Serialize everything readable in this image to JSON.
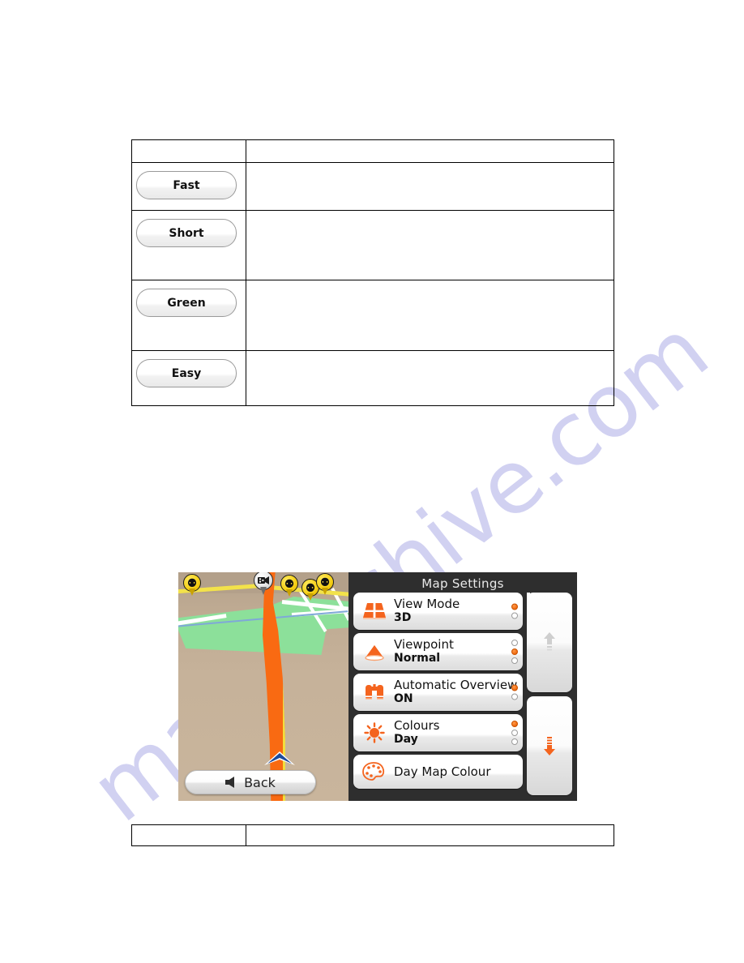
{
  "document": {
    "watermark": "manualshive.com"
  },
  "route_table": {
    "header": {
      "col1": "",
      "col2": ""
    },
    "rows": [
      {
        "button_label": "Fast",
        "description": ""
      },
      {
        "button_label": "Short",
        "description": ""
      },
      {
        "button_label": "Green",
        "description": ""
      },
      {
        "button_label": "Easy",
        "description": ""
      }
    ]
  },
  "bottom_table": {
    "rows": [
      {
        "col1": "",
        "col2": ""
      }
    ]
  },
  "device": {
    "map": {
      "back_button": {
        "label": "Back",
        "icon": "left-arrow-icon"
      },
      "pois": [
        {
          "icon": "pedestrian-crossing-warning-icon",
          "glyph": "⚉"
        },
        {
          "icon": "speed-camera-icon",
          "glyph": "◉"
        },
        {
          "icon": "pedestrian-crossing-warning-icon",
          "glyph": "⚉"
        },
        {
          "icon": "pedestrian-crossing-warning-icon",
          "glyph": "⚉"
        },
        {
          "icon": "pedestrian-crossing-warning-icon",
          "glyph": "⚉"
        }
      ],
      "vehicle_marker": "blue-arrow-position-icon",
      "route_colour": "#f96a12",
      "park_colour": "#8ce09a",
      "ground_colour": "#c6b29a"
    },
    "settings": {
      "title": "Map Settings",
      "accent_colour": "#f06a10",
      "rows": [
        {
          "icon": "view-mode-3d-icon",
          "label": "View Mode",
          "value": "3D",
          "dots": [
            true,
            false
          ]
        },
        {
          "icon": "viewpoint-cone-icon",
          "label": "Viewpoint",
          "value": "Normal",
          "dots": [
            false,
            true,
            false
          ]
        },
        {
          "icon": "binoculars-icon",
          "label": "Automatic Overview",
          "value": "ON",
          "dots": [
            true,
            false
          ]
        },
        {
          "icon": "sun-icon",
          "label": "Colours",
          "value": "Day",
          "dots": [
            true,
            false,
            false
          ]
        },
        {
          "icon": "palette-icon",
          "label": "Day Map Colour",
          "value": "",
          "dots": []
        }
      ],
      "scroll": {
        "up": {
          "icon": "scroll-up-arrow-icon",
          "enabled": false
        },
        "down": {
          "icon": "scroll-down-arrow-icon",
          "enabled": true
        }
      }
    }
  }
}
